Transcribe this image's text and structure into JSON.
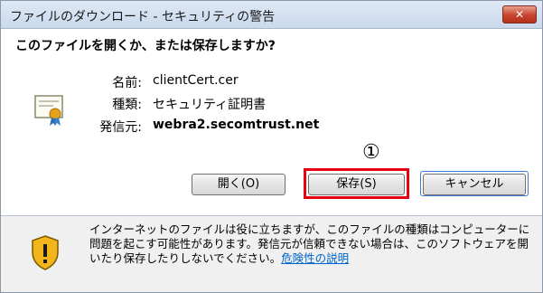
{
  "window": {
    "title": "ファイルのダウンロード - セキュリティの警告",
    "close_glyph": "✕"
  },
  "dialog": {
    "question": "このファイルを開くか、または保存しますか?",
    "info": {
      "name_label": "名前:",
      "name_value": "clientCert.cer",
      "type_label": "種類:",
      "type_value": "セキュリティ証明書",
      "from_label": "発信元:",
      "from_value": "webra2.secomtrust.net"
    },
    "buttons": {
      "open": "開く(O)",
      "save": "保存(S)",
      "cancel": "キャンセル"
    },
    "annotation": {
      "callout": "①",
      "highlight_color": "#e60012"
    },
    "warning": {
      "text": "インターネットのファイルは役に立ちますが、このファイルの種類はコンピューターに問題を起こす可能性があります。発信元が信頼できない場合は、このソフトウェアを開いたり保存したりしないでください。",
      "link": "危険性の説明"
    },
    "icons": {
      "certificate": "certificate-icon",
      "warning": "shield-warning-icon"
    }
  }
}
